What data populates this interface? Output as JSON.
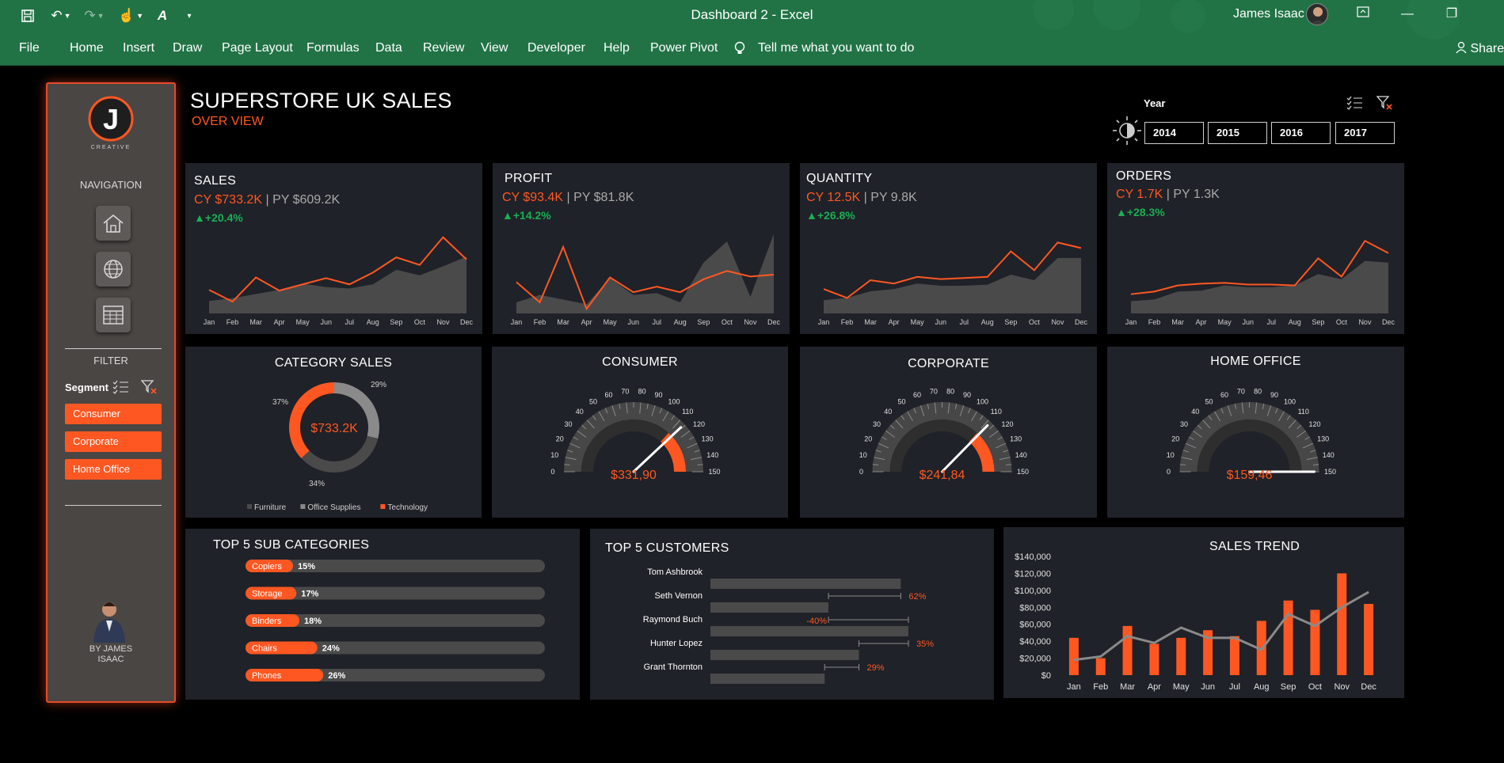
{
  "app": {
    "title": "Dashboard 2  -  Excel",
    "user": "James Isaac",
    "menu": [
      "File",
      "Home",
      "Insert",
      "Draw",
      "Page Layout",
      "Formulas",
      "Data",
      "Review",
      "View",
      "Developer",
      "Help",
      "Power Pivot"
    ],
    "tell_me": "Tell me what you want to do",
    "share": "Share"
  },
  "sidebar": {
    "logo_letter": "J",
    "logo_text": "CREATIVE",
    "nav_label": "NAVIGATION",
    "nav_icons": [
      "home-icon",
      "globe-icon",
      "table-icon"
    ],
    "filter_label": "FILTER",
    "segment_label": "Segment",
    "segments": [
      "Consumer",
      "Corporate",
      "Home Office"
    ],
    "author_line1": "BY JAMES",
    "author_line2": "ISAAC"
  },
  "header": {
    "title": "SUPERSTORE UK SALES",
    "subtitle": "OVER VIEW",
    "year_label": "Year",
    "years": [
      "2014",
      "2015",
      "2016",
      "2017"
    ]
  },
  "kpis": [
    {
      "title": "SALES",
      "cy": "CY $733.2K",
      "py": "PY $609.2K",
      "change": "+20.4%"
    },
    {
      "title": "PROFIT",
      "cy": "CY $93.4K",
      "py": "PY $81.8K",
      "change": "+14.2%"
    },
    {
      "title": "QUANTITY",
      "cy": "CY 12.5K",
      "py": "PY 9.8K",
      "change": "+26.8%"
    },
    {
      "title": "ORDERS",
      "cy": "CY 1.7K",
      "py": "PY 1.3K",
      "change": "+28.3%"
    }
  ],
  "colors": {
    "accent": "#ff5722",
    "card": "#1f2228",
    "area": "#4a4a4a",
    "up": "#1aaf54",
    "line2": "#8a8a8a"
  },
  "chart_data": [
    {
      "type": "line",
      "id": "sales",
      "categories": [
        "Jan",
        "Feb",
        "Mar",
        "Apr",
        "May",
        "Jun",
        "Jul",
        "Aug",
        "Sep",
        "Oct",
        "Nov",
        "Dec"
      ],
      "series": [
        {
          "values": [
            34,
            17,
            52,
            33,
            42,
            51,
            42,
            59,
            81,
            70,
            110,
            78
          ]
        },
        {
          "values": [
            18,
            22,
            28,
            34,
            43,
            38,
            36,
            42,
            63,
            55,
            68,
            82
          ]
        }
      ],
      "ylim": [
        0,
        120
      ]
    },
    {
      "type": "line",
      "id": "profit",
      "categories": [
        "Jan",
        "Feb",
        "Mar",
        "Apr",
        "May",
        "Jun",
        "Jul",
        "Aug",
        "Sep",
        "Oct",
        "Nov",
        "Dec"
      ],
      "series": [
        {
          "values": [
            34,
            12,
            72,
            5,
            39,
            23,
            29,
            23,
            37,
            46,
            40,
            42
          ]
        },
        {
          "values": [
            12,
            20,
            15,
            10,
            38,
            20,
            22,
            12,
            55,
            78,
            18,
            86
          ]
        }
      ],
      "ylim": [
        0,
        90
      ]
    },
    {
      "type": "line",
      "id": "quantity",
      "categories": [
        "Jan",
        "Feb",
        "Mar",
        "Apr",
        "May",
        "Jun",
        "Jul",
        "Aug",
        "Sep",
        "Oct",
        "Nov",
        "Dec"
      ],
      "series": [
        {
          "values": [
            22,
            14,
            30,
            27,
            33,
            31,
            32,
            33,
            56,
            39,
            64,
            59
          ]
        },
        {
          "values": [
            12,
            14,
            20,
            22,
            27,
            25,
            25,
            26,
            35,
            30,
            50,
            50
          ]
        }
      ],
      "ylim": [
        0,
        75
      ]
    },
    {
      "type": "line",
      "id": "orders",
      "categories": [
        "Jan",
        "Feb",
        "Mar",
        "Apr",
        "May",
        "Jun",
        "Jul",
        "Aug",
        "Sep",
        "Oct",
        "Nov",
        "Dec"
      ],
      "series": [
        {
          "values": [
            22,
            25,
            32,
            34,
            35,
            33,
            33,
            32,
            63,
            42,
            83,
            69
          ]
        },
        {
          "values": [
            14,
            16,
            25,
            26,
            32,
            30,
            30,
            32,
            45,
            39,
            60,
            58
          ]
        }
      ],
      "ylim": [
        0,
        95
      ]
    },
    {
      "type": "pie",
      "id": "category_sales",
      "title": "CATEGORY SALES",
      "center_label": "$733.2K",
      "slices": [
        {
          "name": "Furniture",
          "value": 34,
          "label": "34%"
        },
        {
          "name": "Office Supplies",
          "value": 29,
          "label": "29%"
        },
        {
          "name": "Technology",
          "value": 37,
          "label": "37%"
        }
      ]
    },
    {
      "type": "gauge",
      "id": "consumer",
      "title": "CONSUMER",
      "value": 114,
      "label": "$331,90",
      "band": [
        110,
        150
      ],
      "ticks": [
        0,
        10,
        20,
        30,
        40,
        50,
        60,
        70,
        80,
        90,
        100,
        110,
        120,
        130,
        140,
        150
      ]
    },
    {
      "type": "gauge",
      "id": "corporate",
      "title": "CORPORATE",
      "value": 112,
      "label": "$241,84",
      "band": [
        110,
        150
      ],
      "ticks": [
        0,
        10,
        20,
        30,
        40,
        50,
        60,
        70,
        80,
        90,
        100,
        110,
        120,
        130,
        140,
        150
      ]
    },
    {
      "type": "gauge",
      "id": "home_office",
      "title": "HOME OFFICE",
      "value": 150,
      "label": "$159,46",
      "band": [],
      "ticks": [
        0,
        10,
        20,
        30,
        40,
        50,
        60,
        70,
        80,
        90,
        100,
        110,
        120,
        130,
        140,
        150
      ]
    },
    {
      "type": "bar",
      "id": "top_sub",
      "title": "TOP 5 SUB CATEGORIES",
      "categories": [
        "Copiers",
        "Storage",
        "Binders",
        "Chairs",
        "Phones"
      ],
      "values": [
        15,
        17,
        18,
        24,
        26
      ],
      "labels": [
        "15%",
        "17%",
        "18%",
        "24%",
        "26%"
      ]
    },
    {
      "type": "bar",
      "id": "top_customers",
      "title": "TOP 5 CUSTOMERS",
      "categories": [
        "Tom Ashbrook",
        "Seth Vernon",
        "Raymond Buch",
        "Hunter Lopez",
        "Grant Thornton"
      ],
      "values": [
        25000,
        15500,
        26000,
        19500,
        15000
      ],
      "changes": [
        {
          "between": [
            0,
            1
          ],
          "label": "62%"
        },
        {
          "between": [
            1,
            2
          ],
          "label": "-40%"
        },
        {
          "between": [
            2,
            3
          ],
          "label": "35%"
        },
        {
          "between": [
            3,
            4
          ],
          "label": "29%"
        }
      ]
    },
    {
      "type": "bar",
      "id": "sales_trend",
      "title": "SALES TREND",
      "categories": [
        "Jan",
        "Feb",
        "Mar",
        "Apr",
        "May",
        "Jun",
        "Jul",
        "Aug",
        "Sep",
        "Oct",
        "Nov",
        "Dec"
      ],
      "series": [
        {
          "type": "bar",
          "values": [
            44000,
            20000,
            58000,
            37000,
            44000,
            53000,
            46000,
            64000,
            88000,
            77000,
            120000,
            84000
          ]
        },
        {
          "type": "line",
          "values": [
            18000,
            22000,
            46000,
            38000,
            56000,
            44000,
            44000,
            30000,
            72000,
            58000,
            80000,
            98000
          ]
        }
      ],
      "ylim": [
        0,
        140000
      ],
      "yticks": [
        "$0",
        "$20,000",
        "$40,000",
        "$60,000",
        "$80,000",
        "$100,000",
        "$120,000",
        "$140,000"
      ]
    }
  ]
}
